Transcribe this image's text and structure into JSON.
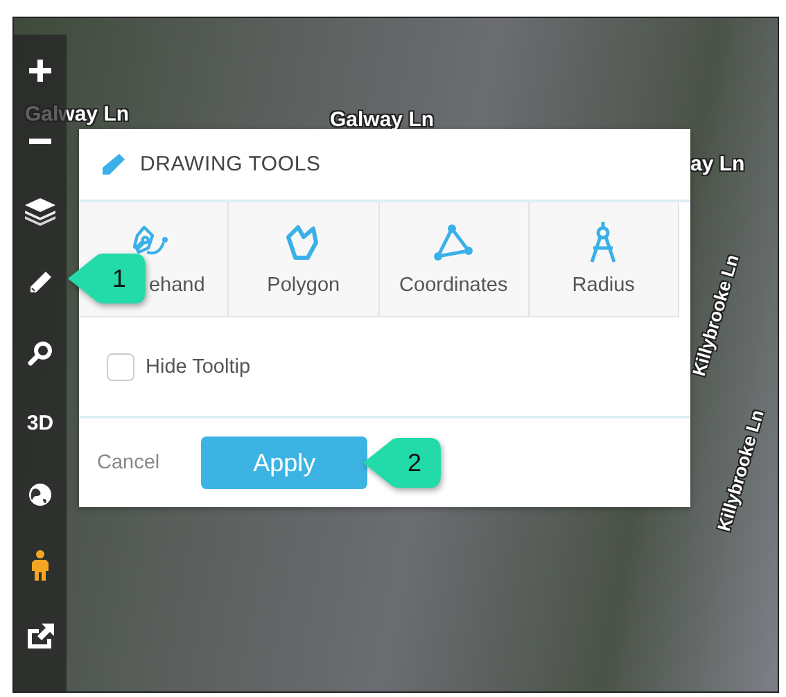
{
  "map": {
    "street_labels": [
      {
        "text": "Galway Ln",
        "kind": "flat"
      },
      {
        "text": "Galway Ln",
        "kind": "flat"
      },
      {
        "text": "ay Ln",
        "kind": "flat"
      },
      {
        "text": "Killybrooke Ln",
        "kind": "steep"
      },
      {
        "text": "Killybrooke Ln",
        "kind": "steep"
      }
    ]
  },
  "toolbar": {
    "items": [
      {
        "kind": "plus"
      },
      {
        "kind": "minus"
      },
      {
        "kind": "layers"
      },
      {
        "kind": "pencil"
      },
      {
        "kind": "search"
      },
      {
        "kind": "text",
        "label": "3D"
      },
      {
        "kind": "globe"
      },
      {
        "kind": "person"
      },
      {
        "kind": "share"
      }
    ]
  },
  "dialog": {
    "title": "DRAWING TOOLS",
    "tools": [
      {
        "kind": "freehand",
        "label": "ehand"
      },
      {
        "kind": "polygon",
        "label": "Polygon"
      },
      {
        "kind": "coordinates",
        "label": "Coordinates"
      },
      {
        "kind": "radius",
        "label": "Radius"
      }
    ],
    "hide_tooltip": {
      "label": "Hide Tooltip",
      "checked": false
    },
    "cancel": "Cancel",
    "apply": "Apply"
  },
  "callouts": [
    {
      "number": "1"
    },
    {
      "number": "2"
    }
  ]
}
